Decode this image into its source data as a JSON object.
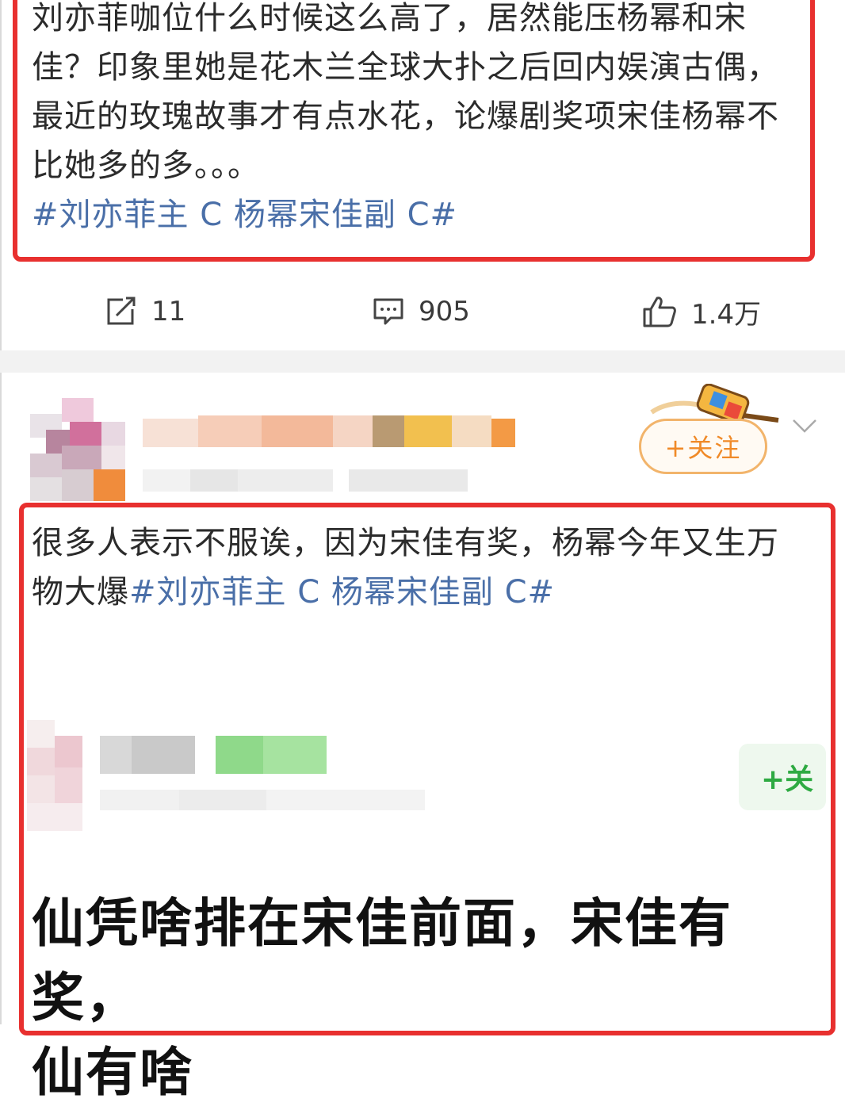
{
  "post1": {
    "text": "刘亦菲咖位什么时候这么高了，居然能压杨幂和宋佳？印象里她是花木兰全球大扑之后回内娱演古偶，最近的玫瑰故事才有点水花，论爆剧奖项宋佳杨幂不比她多的多。。。",
    "hashtag": "#刘亦菲主 C 杨幂宋佳副 C#",
    "actions": {
      "repost_count": "11",
      "comment_count": "905",
      "like_count": "1.4万"
    }
  },
  "post2": {
    "follow_label": "+关注",
    "text": "很多人表示不服诶，因为宋佳有奖，杨幂今年又生万物大爆",
    "hashtag": "#刘亦菲主 C 杨幂宋佳副 C#",
    "embedded_follow_label": "+关",
    "quote_line1": "仙凭啥排在宋佳前面，宋佳有奖，",
    "quote_line2": "仙有啥"
  },
  "colors": {
    "highlight_box": "#e8302f",
    "hashtag": "#4a6fa8",
    "follow_orange": "#f08a28",
    "follow_green": "#2eaa42"
  },
  "icons": {
    "repost": "repost-icon",
    "comment": "comment-icon",
    "like": "like-icon",
    "more": "chevron-down-icon"
  }
}
